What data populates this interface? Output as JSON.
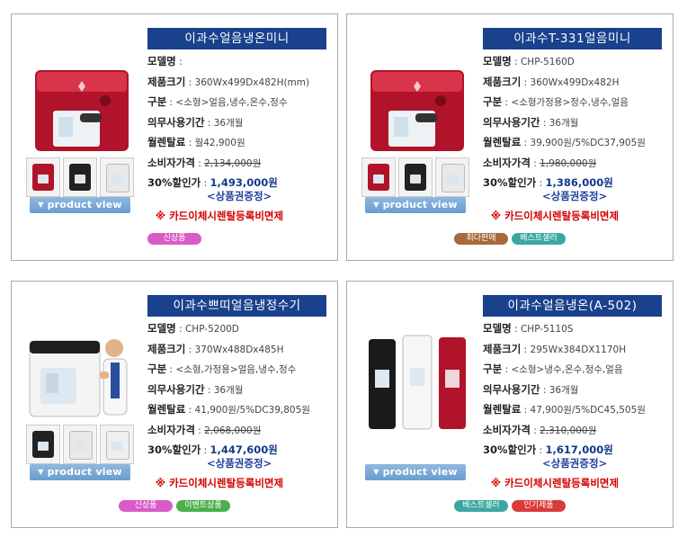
{
  "common": {
    "product_view_label": "product view",
    "gift_label": "<상품권증정>",
    "card_note": "※ 카드이체시렌탈등록비면제",
    "labels": {
      "model": "모델명",
      "size": "제품크기",
      "type": "구분",
      "period": "의무사용기간",
      "rental": "월렌탈료",
      "consumer_price": "소비자가격",
      "sale_price": "30%할인가"
    }
  },
  "products": [
    {
      "title": "이과수얼음냉온미니",
      "model": "",
      "size": "360Wx499Dx482H(mm)",
      "type": "<소형>얼음,냉수,온수,정수",
      "period": "36개월",
      "rental": "월42,900원",
      "consumer_price": "2,134,000원",
      "sale_price": "1,493,000원",
      "badges": [
        "신상품"
      ]
    },
    {
      "title": "이과수T-331얼음미니",
      "model": "CHP-5160D",
      "size": "360Wx499Dx482H",
      "type": "<소형가정용>정수,냉수,얼음",
      "period": "36개월",
      "rental": "39,900원/5%DC37,905원",
      "consumer_price": "1,980,000원",
      "sale_price": "1,386,000원",
      "badges": [
        "최다판매",
        "베스트셀러"
      ]
    },
    {
      "title": "이과수쁘띠얼음냉정수기",
      "model": "CHP-5200D",
      "size": "370Wx488Dx485H",
      "type": "<소형,가정용>얼음,냉수,정수",
      "period": "36개월",
      "rental": "41,900원/5%DC39,805원",
      "consumer_price": "2,068,000원",
      "sale_price": "1,447,600원",
      "badges": [
        "신상품",
        "이벤트상품"
      ]
    },
    {
      "title": "이과수얼음냉온(A-502)",
      "model": "CHP-5110S",
      "size": "295Wx384DX1170H",
      "type": "<소형>냉수,온수,정수,얼음",
      "period": "36개월",
      "rental": "47,900원/5%DC45,505원",
      "consumer_price": "2,310,000원",
      "sale_price": "1,617,000원",
      "badges": [
        "베스트셀러",
        "인기제품"
      ]
    }
  ],
  "colors": {
    "title_bg": "#19418c",
    "note_red": "#d40000",
    "sale_blue": "#123a8a",
    "product_red": "#b0132a"
  }
}
